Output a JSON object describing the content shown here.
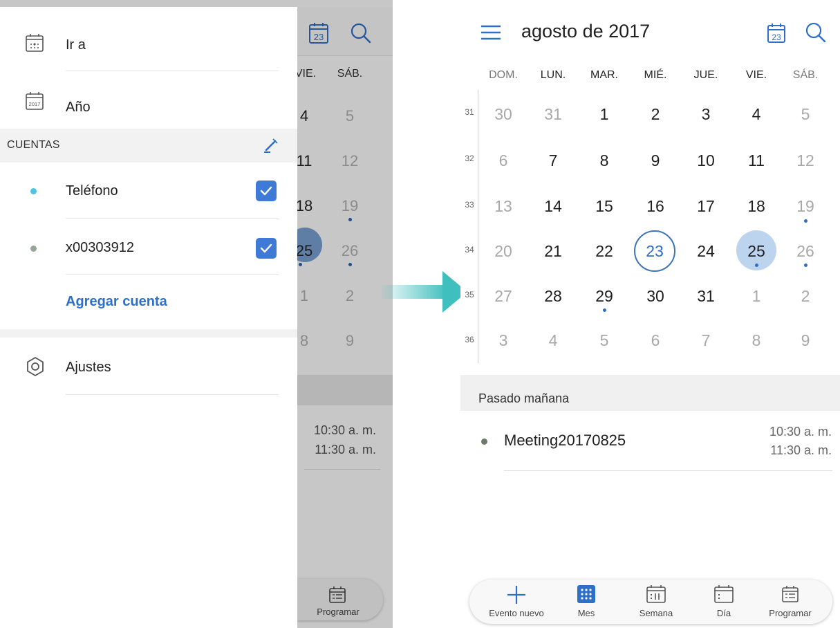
{
  "left_screen": {
    "drawer": {
      "items": [
        {
          "label": "Ir a",
          "icon": "go-to-date-icon"
        },
        {
          "label": "Año",
          "icon": "year-calendar-icon",
          "icon_text": "2017"
        }
      ],
      "accounts_header": "CUENTAS",
      "accounts": [
        {
          "label": "Teléfono",
          "color": "#4cc3e0",
          "checked": true
        },
        {
          "label": "x00303912",
          "color": "#9aa39a",
          "checked": true
        }
      ],
      "add_account": "Agregar cuenta",
      "settings": "Ajustes"
    },
    "calendar_behind": {
      "today_badge": "23",
      "headers": [
        "VIE.",
        "SÁB."
      ],
      "vie_days": [
        "4",
        "11",
        "18",
        "25",
        "1",
        "8"
      ],
      "sab_days": [
        "5",
        "12",
        "19",
        "26",
        "2",
        "9"
      ],
      "times": [
        "10:30 a. m.",
        "11:30 a. m."
      ],
      "nav_label": "Programar"
    }
  },
  "right_screen": {
    "header": {
      "title": "agosto de 2017",
      "today_badge": "23"
    },
    "weekdays": [
      "DOM.",
      "LUN.",
      "MAR.",
      "MIÉ.",
      "JUE.",
      "VIE.",
      "SÁB."
    ],
    "weeks": [
      {
        "num": "31",
        "days": [
          "30",
          "31",
          "1",
          "2",
          "3",
          "4",
          "5"
        ]
      },
      {
        "num": "32",
        "days": [
          "6",
          "7",
          "8",
          "9",
          "10",
          "11",
          "12"
        ]
      },
      {
        "num": "33",
        "days": [
          "13",
          "14",
          "15",
          "16",
          "17",
          "18",
          "19"
        ]
      },
      {
        "num": "34",
        "days": [
          "20",
          "21",
          "22",
          "23",
          "24",
          "25",
          "26"
        ]
      },
      {
        "num": "35",
        "days": [
          "27",
          "28",
          "29",
          "30",
          "31",
          "1",
          "2"
        ]
      },
      {
        "num": "36",
        "days": [
          "3",
          "4",
          "5",
          "6",
          "7",
          "8",
          "9"
        ]
      }
    ],
    "today": "23",
    "selected": "25",
    "agenda": {
      "title": "Pasado mañana",
      "event_name": "Meeting20170825",
      "start_time": "10:30 a. m.",
      "end_time": "11:30 a. m.",
      "event_color": "#6d7b6f"
    },
    "bottom_nav": [
      "Evento nuevo",
      "Mes",
      "Semana",
      "Día",
      "Programar"
    ]
  },
  "colors": {
    "accent": "#2e6fc7",
    "arrow": "#3fbfbd"
  }
}
